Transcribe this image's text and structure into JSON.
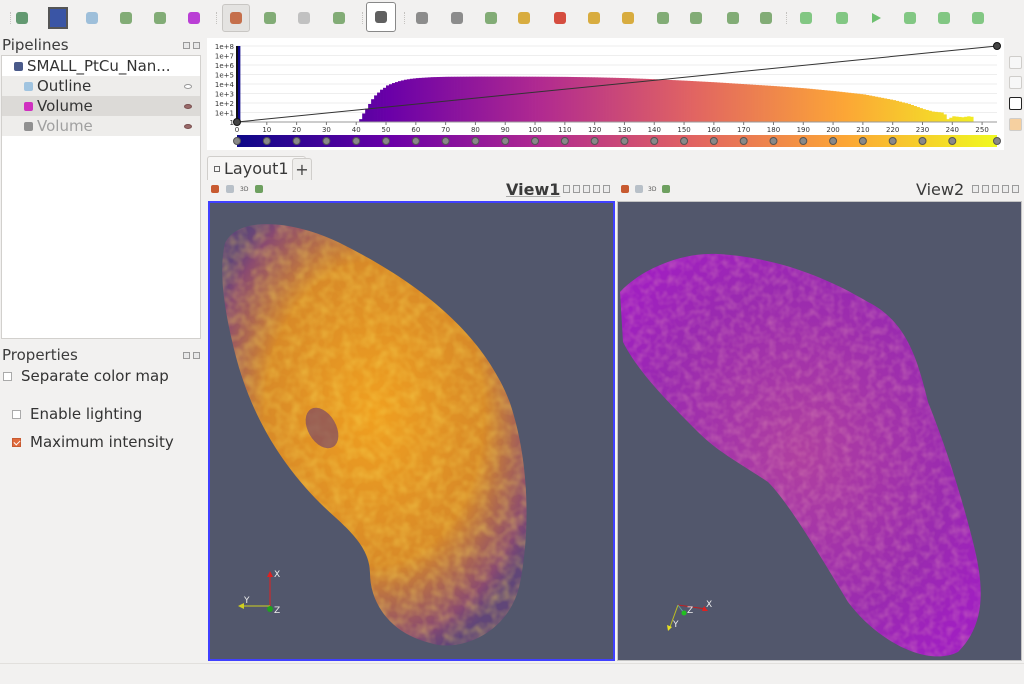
{
  "toolbar": {
    "items": [
      {
        "name": "reset-session-icon",
        "color": "#4a8a5a"
      },
      {
        "name": "outline-box-icon",
        "color": "#3a55a5"
      },
      {
        "name": "axes-star-icon",
        "color": "#8fb6d6"
      },
      {
        "name": "cube-green-icon",
        "color": "#6ea060"
      },
      {
        "name": "cube-clip-icon",
        "color": "#6ea060"
      },
      {
        "name": "volume-cube-icon",
        "color": "#b020d0"
      },
      {
        "name": "interact-axes-icon",
        "color": "#c05a30",
        "active": true
      },
      {
        "name": "rotate-center-icon",
        "color": "#6ea060"
      },
      {
        "name": "rotate-disabled-icon",
        "color": "#b8b8b8"
      },
      {
        "name": "reset-camera-icon",
        "color": "#6ea060"
      },
      {
        "name": "select-hand-icon",
        "color": "#444"
      },
      {
        "name": "zoom-to-data-icon",
        "color": "#7a7a7a"
      },
      {
        "name": "zoom-box-icon",
        "color": "#7a7a7a"
      },
      {
        "name": "select-box-icon",
        "color": "#6ea060"
      },
      {
        "name": "view-plus-x-icon",
        "color": "#d4a020"
      },
      {
        "name": "view-minus-x-icon",
        "color": "#d03020"
      },
      {
        "name": "view-plus-y-icon",
        "color": "#d4a020"
      },
      {
        "name": "view-minus-y-icon",
        "color": "#d4a020"
      },
      {
        "name": "view-plus-z-icon",
        "color": "#6ea060"
      },
      {
        "name": "view-minus-z-icon",
        "color": "#6ea060"
      },
      {
        "name": "rotate-plus-90-icon",
        "color": "#6ea060"
      },
      {
        "name": "rotate-minus-90-icon",
        "color": "#6ea060"
      },
      {
        "name": "first-frame-icon",
        "color": "#6ec070"
      },
      {
        "name": "prev-frame-icon",
        "color": "#6ec070"
      },
      {
        "name": "play-icon",
        "color": "#6ec070"
      },
      {
        "name": "next-frame-icon",
        "color": "#6ec070"
      },
      {
        "name": "last-frame-icon",
        "color": "#6ec070"
      },
      {
        "name": "loop-icon",
        "color": "#6ec070"
      }
    ]
  },
  "pipelines": {
    "title": "Pipelines",
    "items": [
      {
        "label": "SMALL_PtCu_Nan...",
        "icon": "dataset-icon",
        "icon_color": "#4a5a8a",
        "visible": null,
        "selected": false,
        "disabled": false,
        "indent": 0
      },
      {
        "label": "Outline",
        "icon": "outline-icon",
        "icon_color": "#a0c4e0",
        "visible": false,
        "selected": false,
        "disabled": false,
        "indent": 1
      },
      {
        "label": "Volume",
        "icon": "volume-icon",
        "icon_color": "#d030c0",
        "visible": true,
        "selected": true,
        "disabled": false,
        "indent": 1
      },
      {
        "label": "Volume",
        "icon": "volume-icon",
        "icon_color": "#909090",
        "visible": true,
        "selected": false,
        "disabled": true,
        "indent": 1
      }
    ]
  },
  "properties": {
    "title": "Properties",
    "separate_color_map": {
      "label": "Separate color map",
      "checked": false
    },
    "enable_lighting": {
      "label": "Enable lighting",
      "checked": false
    },
    "maximum_intensity": {
      "label": "Maximum intensity",
      "checked": true
    }
  },
  "chart_data": {
    "type": "bar",
    "title": "",
    "xlabel": "",
    "ylabel": "",
    "yscale": "log",
    "xlim": [
      0,
      255
    ],
    "ylim_labels": [
      "1",
      "1e+1",
      "1e+2",
      "1e+3",
      "1e+4",
      "1e+5",
      "1e+6",
      "1e+7",
      "1e+8"
    ],
    "x_ticks": [
      "0",
      "10",
      "20",
      "30",
      "40",
      "50",
      "60",
      "70",
      "80",
      "90",
      "100",
      "110",
      "120",
      "130",
      "140",
      "150",
      "160",
      "170",
      "180",
      "190",
      "200",
      "210",
      "220",
      "230",
      "240",
      "250"
    ],
    "histogram_log10": [
      [
        0,
        8
      ],
      [
        41,
        0.3
      ],
      [
        42,
        0.9
      ],
      [
        43,
        1.4
      ],
      [
        44,
        1.9
      ],
      [
        45,
        2.4
      ],
      [
        46,
        2.8
      ],
      [
        47,
        3.1
      ],
      [
        48,
        3.4
      ],
      [
        49,
        3.6
      ],
      [
        50,
        3.85
      ],
      [
        52,
        4.1
      ],
      [
        54,
        4.3
      ],
      [
        56,
        4.45
      ],
      [
        58,
        4.55
      ],
      [
        60,
        4.62
      ],
      [
        65,
        4.72
      ],
      [
        70,
        4.76
      ],
      [
        80,
        4.78
      ],
      [
        90,
        4.78
      ],
      [
        100,
        4.77
      ],
      [
        110,
        4.75
      ],
      [
        120,
        4.7
      ],
      [
        130,
        4.62
      ],
      [
        140,
        4.5
      ],
      [
        150,
        4.35
      ],
      [
        160,
        4.18
      ],
      [
        170,
        3.98
      ],
      [
        180,
        3.78
      ],
      [
        190,
        3.55
      ],
      [
        200,
        3.25
      ],
      [
        210,
        2.9
      ],
      [
        215,
        2.6
      ],
      [
        220,
        2.3
      ],
      [
        225,
        1.9
      ],
      [
        230,
        1.35
      ],
      [
        233,
        1.1
      ],
      [
        236,
        1.0
      ],
      [
        237,
        0.8
      ],
      [
        238,
        0.3
      ],
      [
        240,
        0.6
      ],
      [
        243,
        0.5
      ],
      [
        245,
        0.6
      ],
      [
        246,
        0.55
      ],
      [
        247,
        0
      ]
    ],
    "opacity_function": [
      [
        0,
        0.0
      ],
      [
        255,
        1.0
      ]
    ],
    "colormap_stops": [
      "#0d0887",
      "#6a00a8",
      "#b12a90",
      "#e16462",
      "#fca636",
      "#f0f921"
    ],
    "color_points": [
      0,
      10,
      20,
      30,
      40,
      50,
      60,
      70,
      80,
      90,
      100,
      110,
      120,
      130,
      140,
      150,
      160,
      170,
      180,
      190,
      200,
      210,
      220,
      230,
      240,
      255
    ]
  },
  "layout": {
    "tab_label": "Layout1",
    "add_tab_label": "+"
  },
  "views": {
    "view1": {
      "title": "View1",
      "active": true,
      "mode_3d": "3D"
    },
    "view2": {
      "title": "View2",
      "active": false,
      "mode_3d": "3D"
    },
    "background": "#52576c"
  },
  "orientation_axes": {
    "x": "X",
    "y": "Y",
    "z": "Z"
  }
}
